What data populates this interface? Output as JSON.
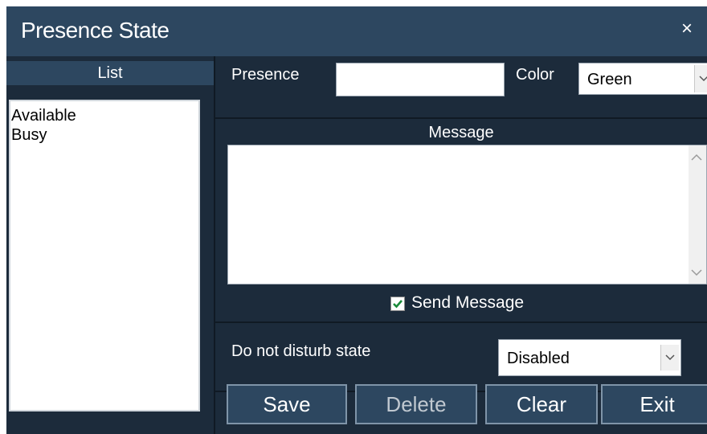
{
  "window": {
    "title": "Presence State",
    "close_glyph": "×"
  },
  "list": {
    "header": "List",
    "items": [
      "Available",
      "Busy"
    ]
  },
  "form": {
    "presence_label": "Presence",
    "presence_value": "",
    "color_label": "Color",
    "color_value": "Green",
    "message_label": "Message",
    "message_value": "",
    "send_message_label": "Send Message",
    "send_message_checked": true,
    "dnd_label": "Do not disturb state",
    "dnd_value": "Disabled"
  },
  "buttons": {
    "save": "Save",
    "delete": "Delete",
    "clear": "Clear",
    "exit": "Exit"
  },
  "icons": {
    "close": "close-icon",
    "dropdown": "chevron-down-icon",
    "scroll_up": "chevron-up-icon",
    "scroll_down": "chevron-down-icon",
    "check": "check-icon"
  },
  "colors": {
    "window_bg": "#1c2b3b",
    "header_bg": "#2d4760",
    "check_green": "#1a8a3a"
  }
}
